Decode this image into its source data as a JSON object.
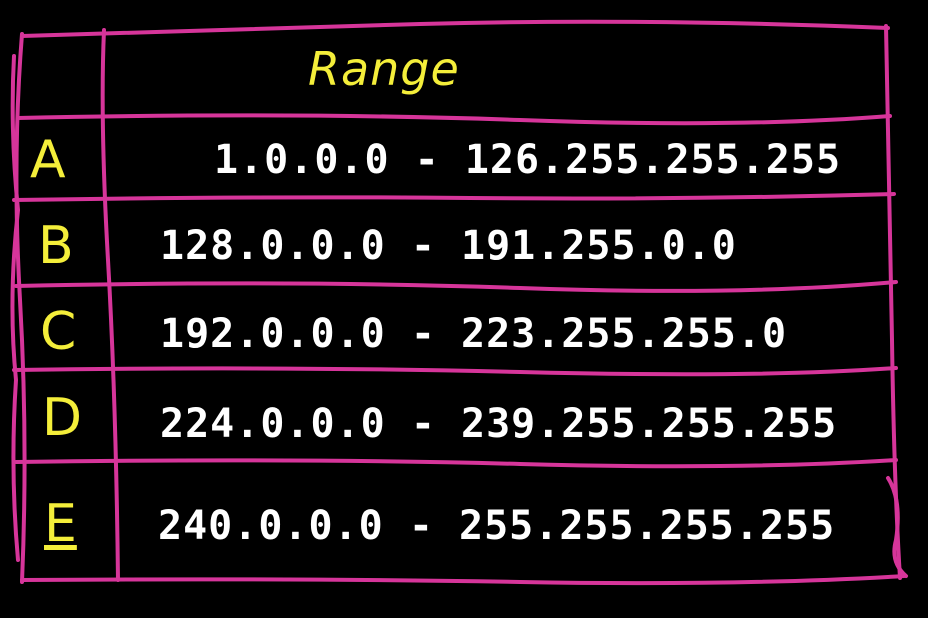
{
  "table": {
    "header": "Range",
    "rows": [
      {
        "class": "A",
        "range": "1.0.0.0 - 126.255.255.255"
      },
      {
        "class": "B",
        "range": "128.0.0.0 - 191.255.0.0"
      },
      {
        "class": "C",
        "range": "192.0.0.0 - 223.255.255.0"
      },
      {
        "class": "D",
        "range": "224.0.0.0 - 239.255.255.255"
      },
      {
        "class": "E",
        "range": "240.0.0.0 - 255.255.255.255"
      }
    ]
  },
  "colors": {
    "background": "#000000",
    "grid_line": "#D6359A",
    "letters": "#F4EE3A",
    "ranges": "#FFFFFF"
  }
}
